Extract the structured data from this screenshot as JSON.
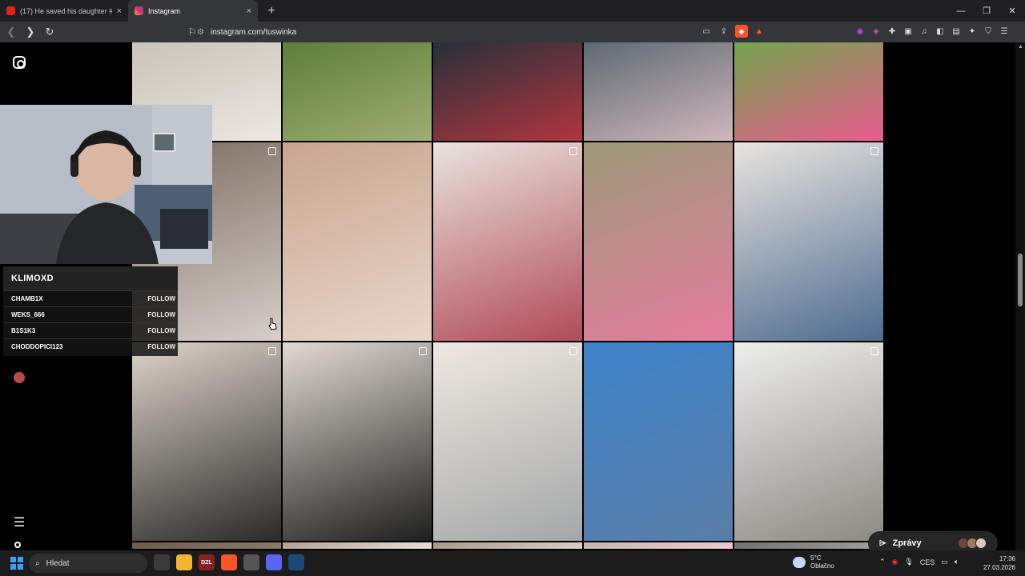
{
  "browser": {
    "tabs": [
      {
        "title": "(17) He saved his daughter #shorts #",
        "active": false
      },
      {
        "title": "Instagram",
        "active": true
      }
    ],
    "new_tab": "+",
    "url": "instagram.com/tuswinka",
    "window_controls": [
      "minimize-icon",
      "restore-icon",
      "close-icon"
    ]
  },
  "instagram": {
    "messages_label": "Zprávy",
    "icons": [
      "instagram-icon",
      "menu-icon",
      "more-icon"
    ]
  },
  "overlay": {
    "chat_title": "KLIMOXD",
    "follow_label": "FOLLOW",
    "followers": [
      {
        "name": "CHAMB1X"
      },
      {
        "name": "WEKS_666"
      },
      {
        "name": "B1S1K3"
      },
      {
        "name": "CHODDOPICI123"
      }
    ]
  },
  "grid": {
    "rows": [
      {
        "kind": "top",
        "items": [
          {
            "colors": [
              "#c9c3b9",
              "#ece8e0"
            ]
          },
          {
            "colors": [
              "#5f7d39",
              "#9eae74"
            ]
          },
          {
            "colors": [
              "#27303a",
              "#b1353e"
            ]
          },
          {
            "colors": [
              "#5d6a70",
              "#cfb7bd"
            ]
          },
          {
            "colors": [
              "#73a54e",
              "#e95c8f"
            ]
          }
        ]
      },
      {
        "kind": "mid",
        "items": [
          {
            "colors": [
              "#7d6d63",
              "#d6cec8"
            ],
            "multi": true
          },
          {
            "colors": [
              "#c9a58e",
              "#e8d7cb"
            ],
            "multi": false
          },
          {
            "colors": [
              "#e9e4dd",
              "#b14a5a"
            ],
            "multi": true
          },
          {
            "colors": [
              "#9d9a7a",
              "#e67c9e"
            ],
            "multi": false
          },
          {
            "colors": [
              "#e9e4df",
              "#4e6c8f"
            ],
            "multi": true
          }
        ]
      },
      {
        "kind": "mid",
        "items": [
          {
            "colors": [
              "#ddd4c9",
              "#2a2a2a"
            ],
            "multi": true
          },
          {
            "colors": [
              "#e1dad2",
              "#1e1e1e"
            ],
            "multi": true
          },
          {
            "colors": [
              "#efe8e0",
              "#a4a7a9"
            ],
            "multi": true
          },
          {
            "colors": [
              "#3d83c9",
              "#5a7da7"
            ],
            "multi": false
          },
          {
            "colors": [
              "#eeeeea",
              "#8d8a85"
            ],
            "multi": true
          }
        ]
      },
      {
        "kind": "bot",
        "items": [
          {
            "colors": [
              "#6c5a4a",
              "#8c7a6a"
            ]
          },
          {
            "colors": [
              "#b0a090",
              "#e8e0d8"
            ]
          },
          {
            "colors": [
              "#a89888",
              "#d8d0c8"
            ]
          },
          {
            "colors": [
              "#c0b8b0",
              "#f0c8d0"
            ]
          },
          {
            "colors": [
              "#707070",
              "#a0a0a0"
            ]
          }
        ]
      }
    ]
  },
  "taskbar": {
    "search_placeholder": "Hledat",
    "apps": [
      {
        "name": "task-view",
        "label": "",
        "color": "#3b3b3b"
      },
      {
        "name": "file-explorer",
        "label": "",
        "color": "#f2b632"
      },
      {
        "name": "dzl-app",
        "label": "DZL",
        "color": "#8b1f1f"
      },
      {
        "name": "brave-browser",
        "label": "",
        "color": "#fb542b"
      },
      {
        "name": "app-circle",
        "label": "",
        "color": "#555555"
      },
      {
        "name": "discord",
        "label": "",
        "color": "#5865f2"
      },
      {
        "name": "steam",
        "label": "",
        "color": "#1b4a7a"
      }
    ],
    "weather": {
      "temp": "5°C",
      "desc": "Oblačno"
    },
    "language": "CES",
    "time": "17:36",
    "date": "27.03.2026"
  }
}
